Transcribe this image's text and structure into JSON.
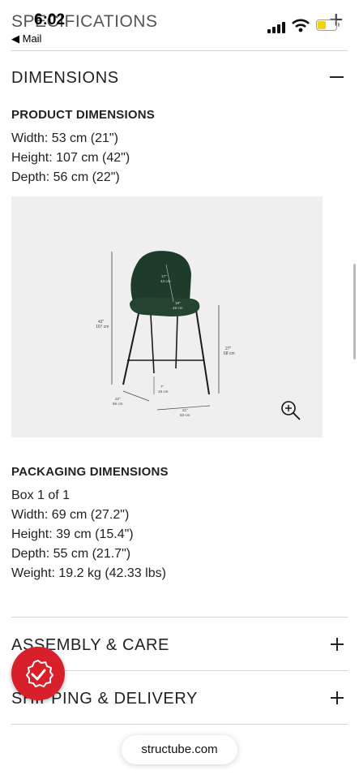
{
  "status_bar": {
    "time": "6:02",
    "back_label": "◀ Mail"
  },
  "header": {
    "title": "SPECIFICATIONS"
  },
  "accordion": {
    "dimensions": "DIMENSIONS",
    "assembly": "ASSEMBLY & CARE",
    "shipping": "SHIPPING & DELIVERY"
  },
  "product_dimensions": {
    "heading": "PRODUCT DIMENSIONS",
    "lines": [
      "Width: 53 cm (21\")",
      "Height: 107 cm (42\")",
      "Depth: 56 cm (22\")"
    ]
  },
  "diagram_labels": {
    "height_in": "42\"",
    "height_cm": "107 cm",
    "back_in": "17\"",
    "back_cm": "43 cm",
    "seat_in": "18\"",
    "seat_cm": "45 cm",
    "seat_h_in": "27\"",
    "seat_h_cm": "68 cm",
    "foot_in": "7\"",
    "foot_cm": "19 cm",
    "depth_in": "22\"",
    "depth_cm": "56 cm",
    "width_in": "21\"",
    "width_cm": "53 cm"
  },
  "packaging_dimensions": {
    "heading": "PACKAGING DIMENSIONS",
    "lines": [
      "Box 1 of 1",
      "Width: 69 cm (27.2\")",
      "Height: 39 cm (15.4\")",
      "Depth: 55 cm (21.7\")",
      "Weight: 19.2 kg (42.33 lbs)"
    ]
  },
  "footer": {
    "url": "structube.com"
  },
  "colors": {
    "accent": "#d8202a",
    "chair_green": "#1f3b2a",
    "battery": "#f2d20d"
  },
  "icons": [
    "signal-icon",
    "wifi-icon",
    "battery-icon",
    "zoom-icon",
    "check-badge-icon",
    "plus-icon",
    "minus-icon"
  ]
}
